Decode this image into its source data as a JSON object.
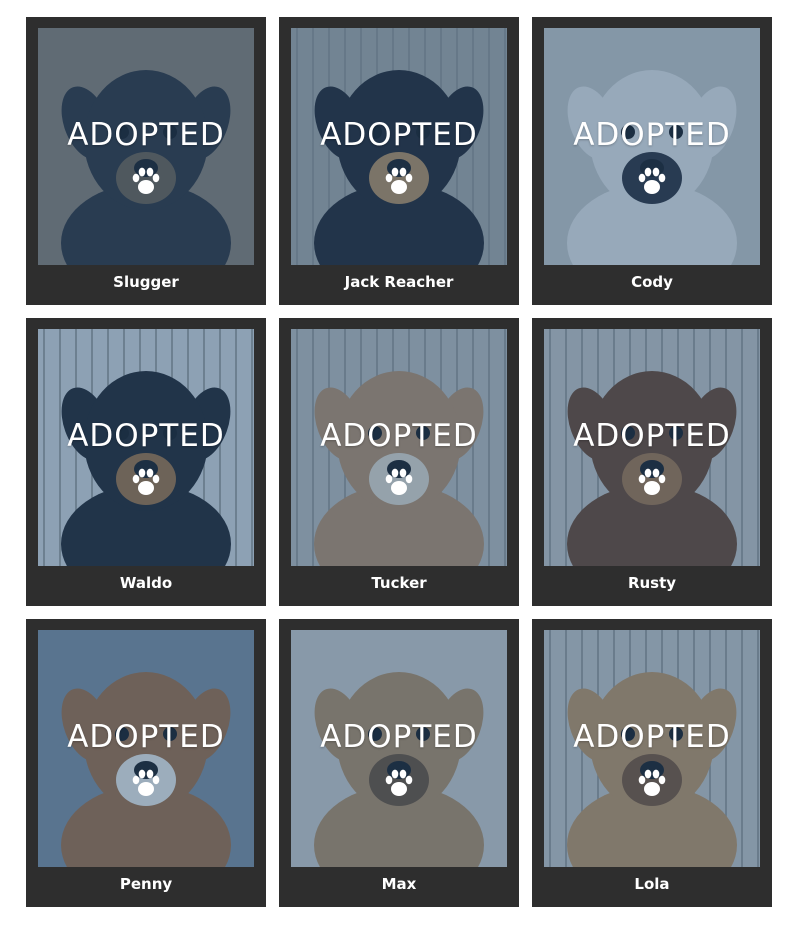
{
  "colors": {
    "frame": "#2e2e2e",
    "overlay_tint": "#265682",
    "text": "#ffffff"
  },
  "overlay": {
    "label": "ADOPTED",
    "icon": "paw-print-icon"
  },
  "pets": [
    {
      "name": "Slugger",
      "status": "ADOPTED",
      "fur": "#2b2a2e",
      "accent": "#6d5a44",
      "bg": "#8a7a6a"
    },
    {
      "name": "Jack Reacher",
      "status": "ADOPTED",
      "fur": "#1f1d22",
      "accent": "#b98a55",
      "bg": "#a9a59f"
    },
    {
      "name": "Cody",
      "status": "ADOPTED",
      "fur": "#e9e6e2",
      "accent": "#2a2830",
      "bg": "#c9c6c2"
    },
    {
      "name": "Waldo",
      "status": "ADOPTED",
      "fur": "#1e1c20",
      "accent": "#a06d3a",
      "bg": "#d8d8d8"
    },
    {
      "name": "Tucker",
      "status": "ADOPTED",
      "fur": "#b88c62",
      "accent": "#e6d9c8",
      "bg": "#bdbab6"
    },
    {
      "name": "Rusty",
      "status": "ADOPTED",
      "fur": "#6b3f22",
      "accent": "#a6713f",
      "bg": "#c8c3bd"
    },
    {
      "name": "Penny",
      "status": "ADOPTED",
      "fur": "#a26a3c",
      "accent": "#f1ece6",
      "bg": "#7f8a98"
    },
    {
      "name": "Max",
      "status": "ADOPTED",
      "fur": "#b48a5c",
      "accent": "#6c4a2c",
      "bg": "#cfcac4"
    },
    {
      "name": "Lola",
      "status": "ADOPTED",
      "fur": "#c2915b",
      "accent": "#7a4e2a",
      "bg": "#c9c5c0"
    }
  ]
}
